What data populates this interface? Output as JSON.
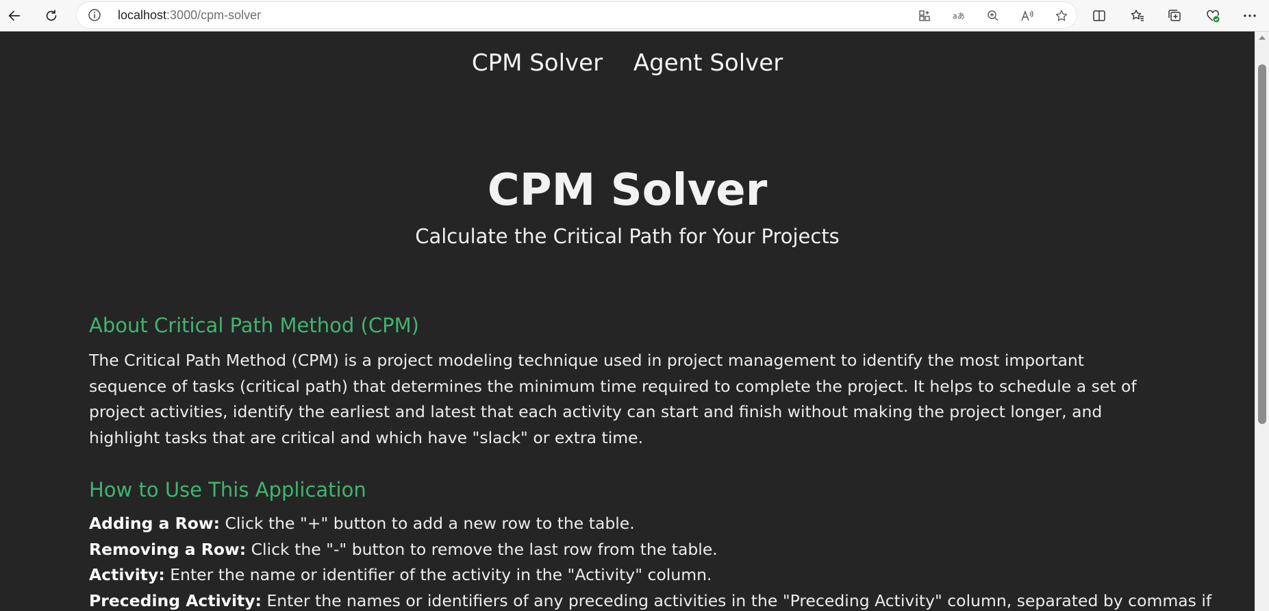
{
  "browser": {
    "url_host": "localhost",
    "url_path": ":3000/cpm-solver",
    "icons": [
      "back-icon",
      "refresh-icon",
      "info-icon",
      "app-available-icon",
      "translate-icon",
      "zoom-icon",
      "read-aloud-icon",
      "favorite-star-icon",
      "split-screen-icon",
      "favorites-icon",
      "collections-icon",
      "browser-essentials-icon",
      "more-icon"
    ]
  },
  "nav": {
    "links": [
      {
        "label": "CPM Solver"
      },
      {
        "label": "Agent Solver"
      }
    ]
  },
  "hero": {
    "title": "CPM Solver",
    "subtitle": "Calculate the Critical Path for Your Projects"
  },
  "about": {
    "heading": "About Critical Path Method (CPM)",
    "paragraph": "The Critical Path Method (CPM) is a project modeling technique used in project management to identify the most important sequence of tasks (critical path) that determines the minimum time required to complete the project. It helps to schedule a set of project activities, identify the earliest and latest that each activity can start and finish without making the project longer, and highlight tasks that are critical and which have \"slack\" or extra time."
  },
  "howto": {
    "heading": "How to Use This Application",
    "items": [
      {
        "term": "Adding a Row:",
        "desc": " Click the \"+\" button to add a new row to the table."
      },
      {
        "term": "Removing a Row:",
        "desc": " Click the \"-\" button to remove the last row from the table."
      },
      {
        "term": "Activity:",
        "desc": " Enter the name or identifier of the activity in the \"Activity\" column."
      },
      {
        "term": "Preceding Activity:",
        "desc": " Enter the names or identifiers of any preceding activities in the \"Preceding Activity\" column, separated by commas if"
      }
    ]
  },
  "colors": {
    "page_bg": "#252525",
    "accent_green": "#3fb56f",
    "text": "#f2f2f2"
  }
}
